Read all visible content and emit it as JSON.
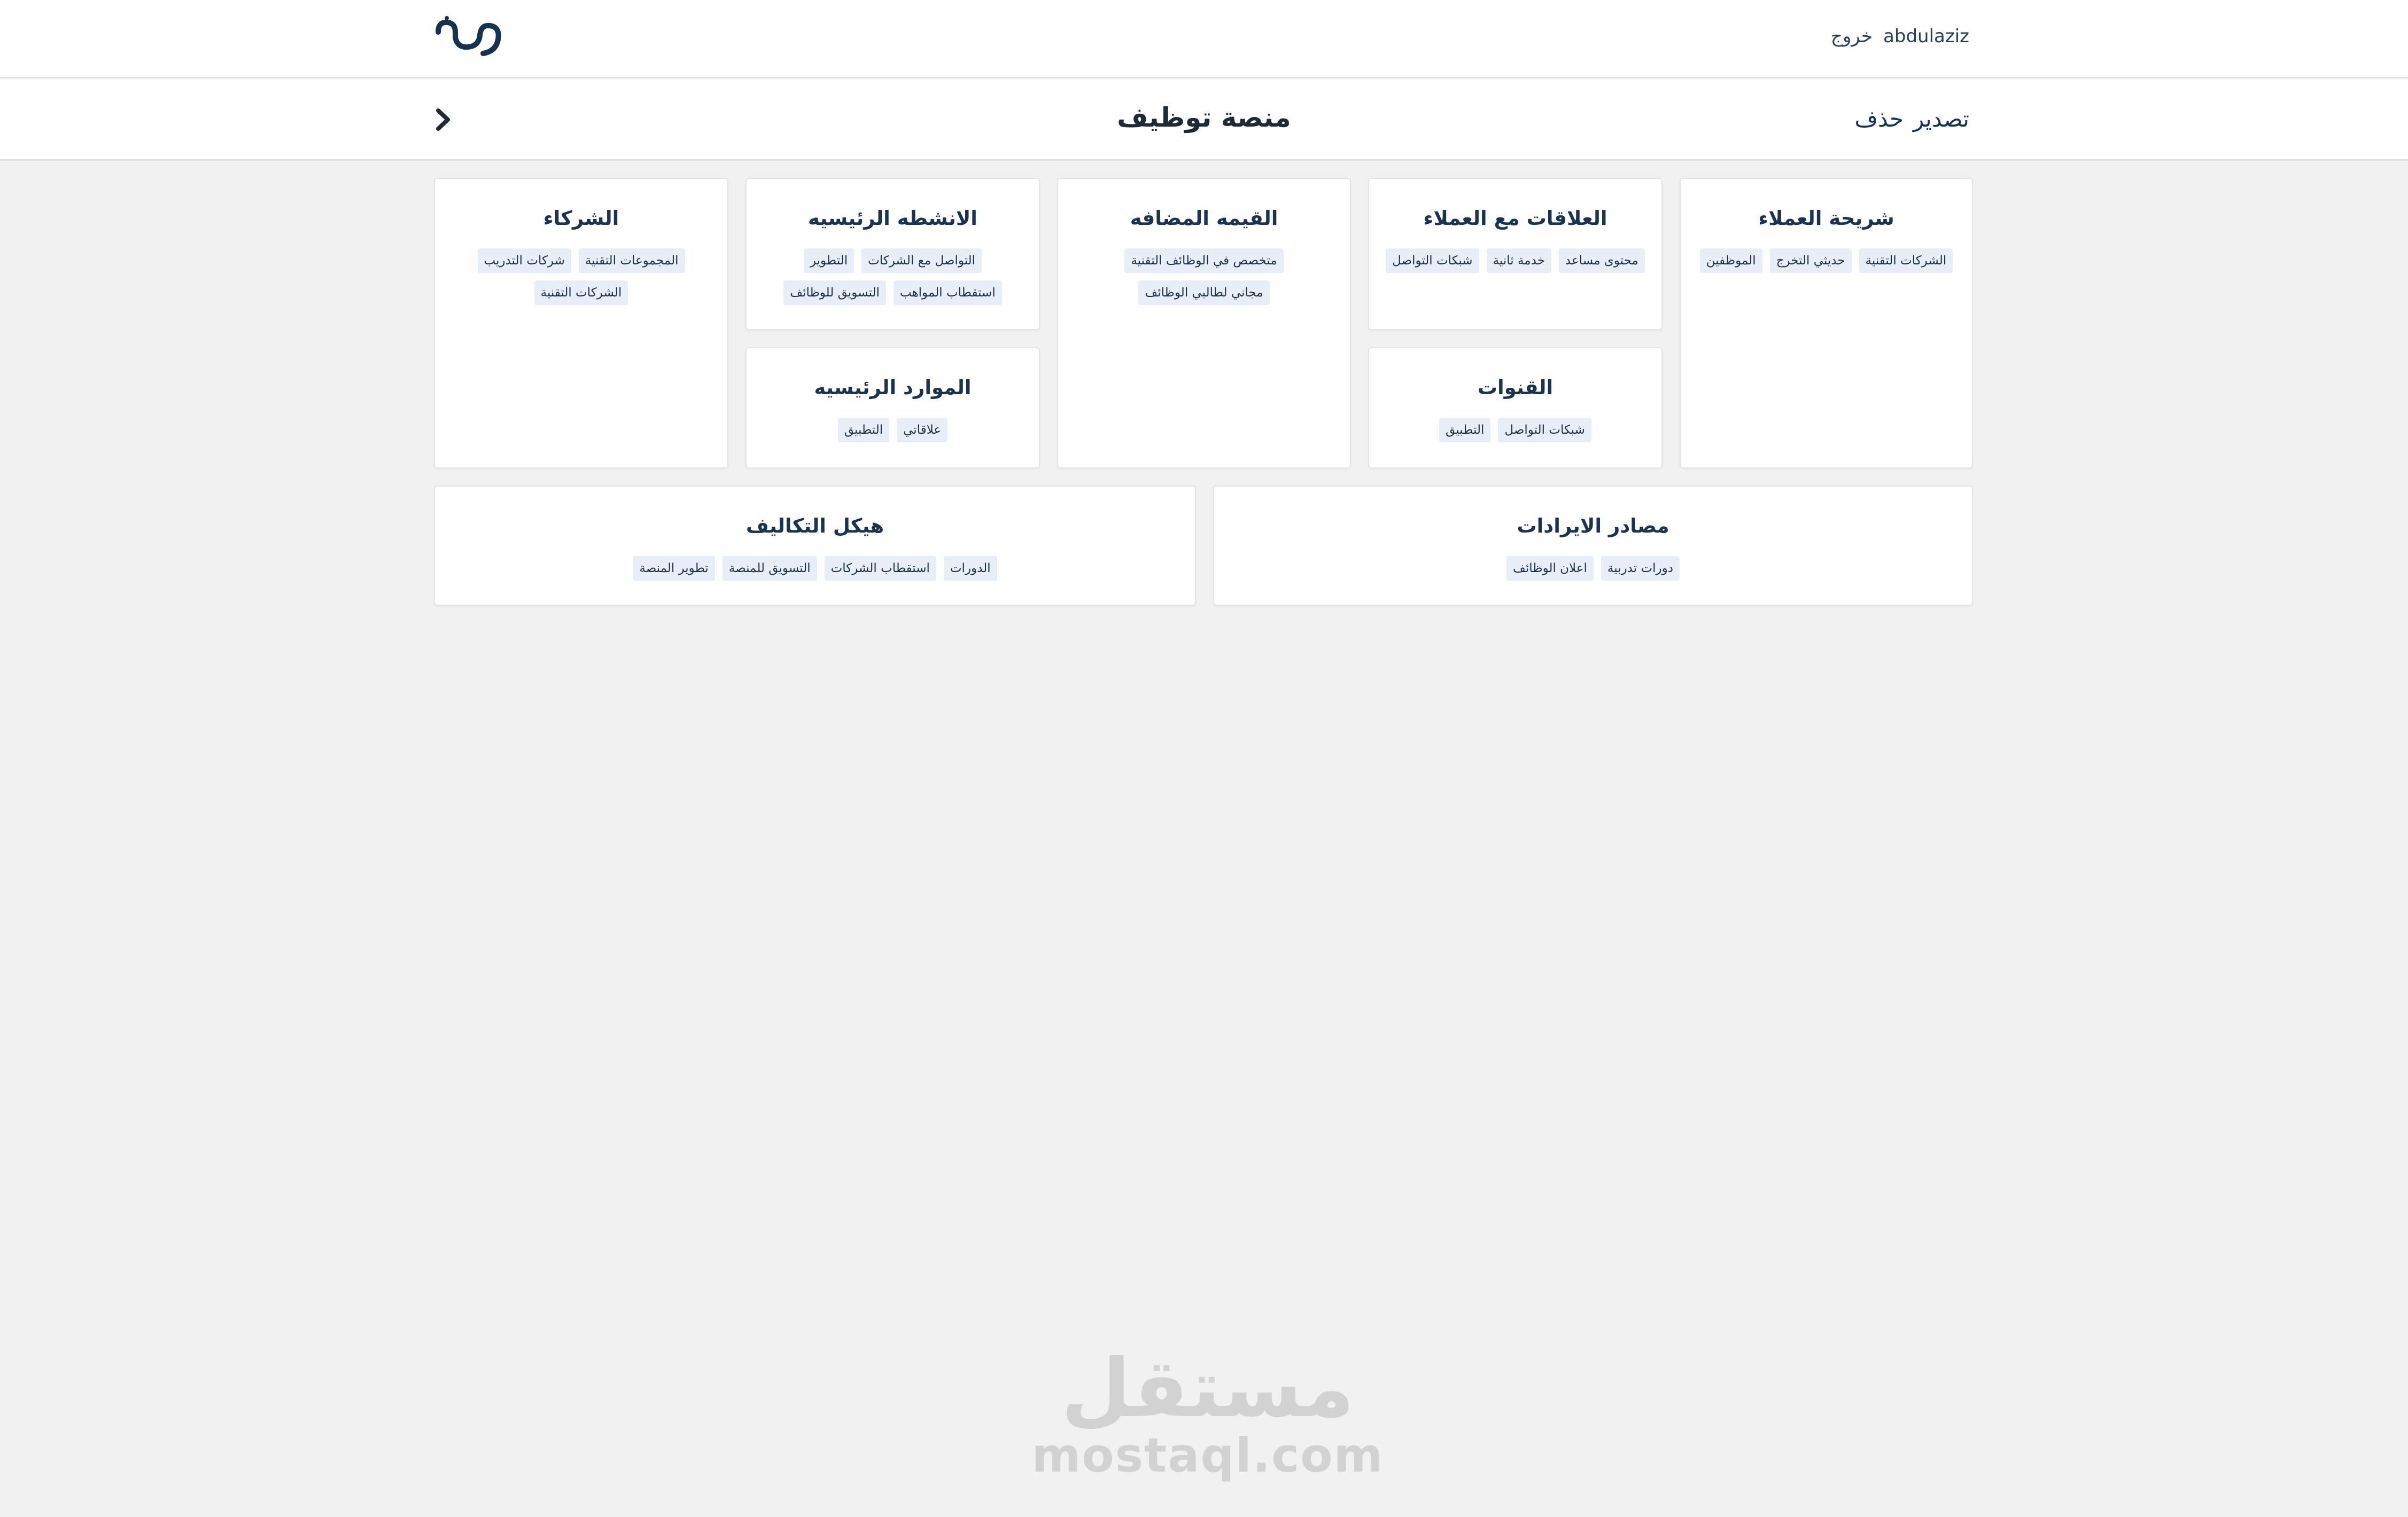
{
  "header": {
    "logo_icon": "nooh-logo-icon",
    "username": "abdulaziz",
    "logout_label": "خروج"
  },
  "titlebar": {
    "title": "منصة توظيف",
    "export_label": "تصدير",
    "delete_label": "حذف",
    "back_icon": "chevron-right-icon"
  },
  "cards": {
    "customer_segments": {
      "title": "شريحة العملاء",
      "tags": [
        "الشركات التقنية",
        "حديثي التخرج",
        "الموظفين"
      ]
    },
    "customer_relationships": {
      "title": "العلاقات مع العملاء",
      "tags": [
        "محتوى مساعد",
        "خدمة ثانية",
        "شبكات التواصل"
      ]
    },
    "channels": {
      "title": "القنوات",
      "tags": [
        "شبكات التواصل",
        "التطبيق"
      ]
    },
    "value_proposition": {
      "title": "القيمه المضافه",
      "tags": [
        "متخصص في الوظائف التقنية",
        "مجاني لطالبي الوظائف"
      ]
    },
    "key_activities": {
      "title": "الانشطه الرئيسيه",
      "tags": [
        "التواصل مع الشركات",
        "التطوير",
        "استقطاب المواهب",
        "التسويق للوظائف"
      ]
    },
    "key_resources": {
      "title": "الموارد الرئيسيه",
      "tags": [
        "علاقاتي",
        "التطبيق"
      ]
    },
    "partners": {
      "title": "الشركاء",
      "tags": [
        "المجموعات التقنية",
        "شركات التدريب",
        "الشركات التقنية"
      ]
    },
    "revenue_streams": {
      "title": "مصادر الايرادات",
      "tags": [
        "دورات تدربية",
        "اعلان الوظائف"
      ]
    },
    "cost_structure": {
      "title": "هيكل التكاليف",
      "tags": [
        "الدورات",
        "استقطاب الشركات",
        "التسويق للمنصة",
        "تطوير المنصة"
      ]
    }
  },
  "watermark": {
    "arabic": "مستقل",
    "latin": "mostaql.com"
  },
  "colors": {
    "brand": "#17324f",
    "background": "#f1f1f1",
    "tag_bg": "#e8eef7"
  }
}
